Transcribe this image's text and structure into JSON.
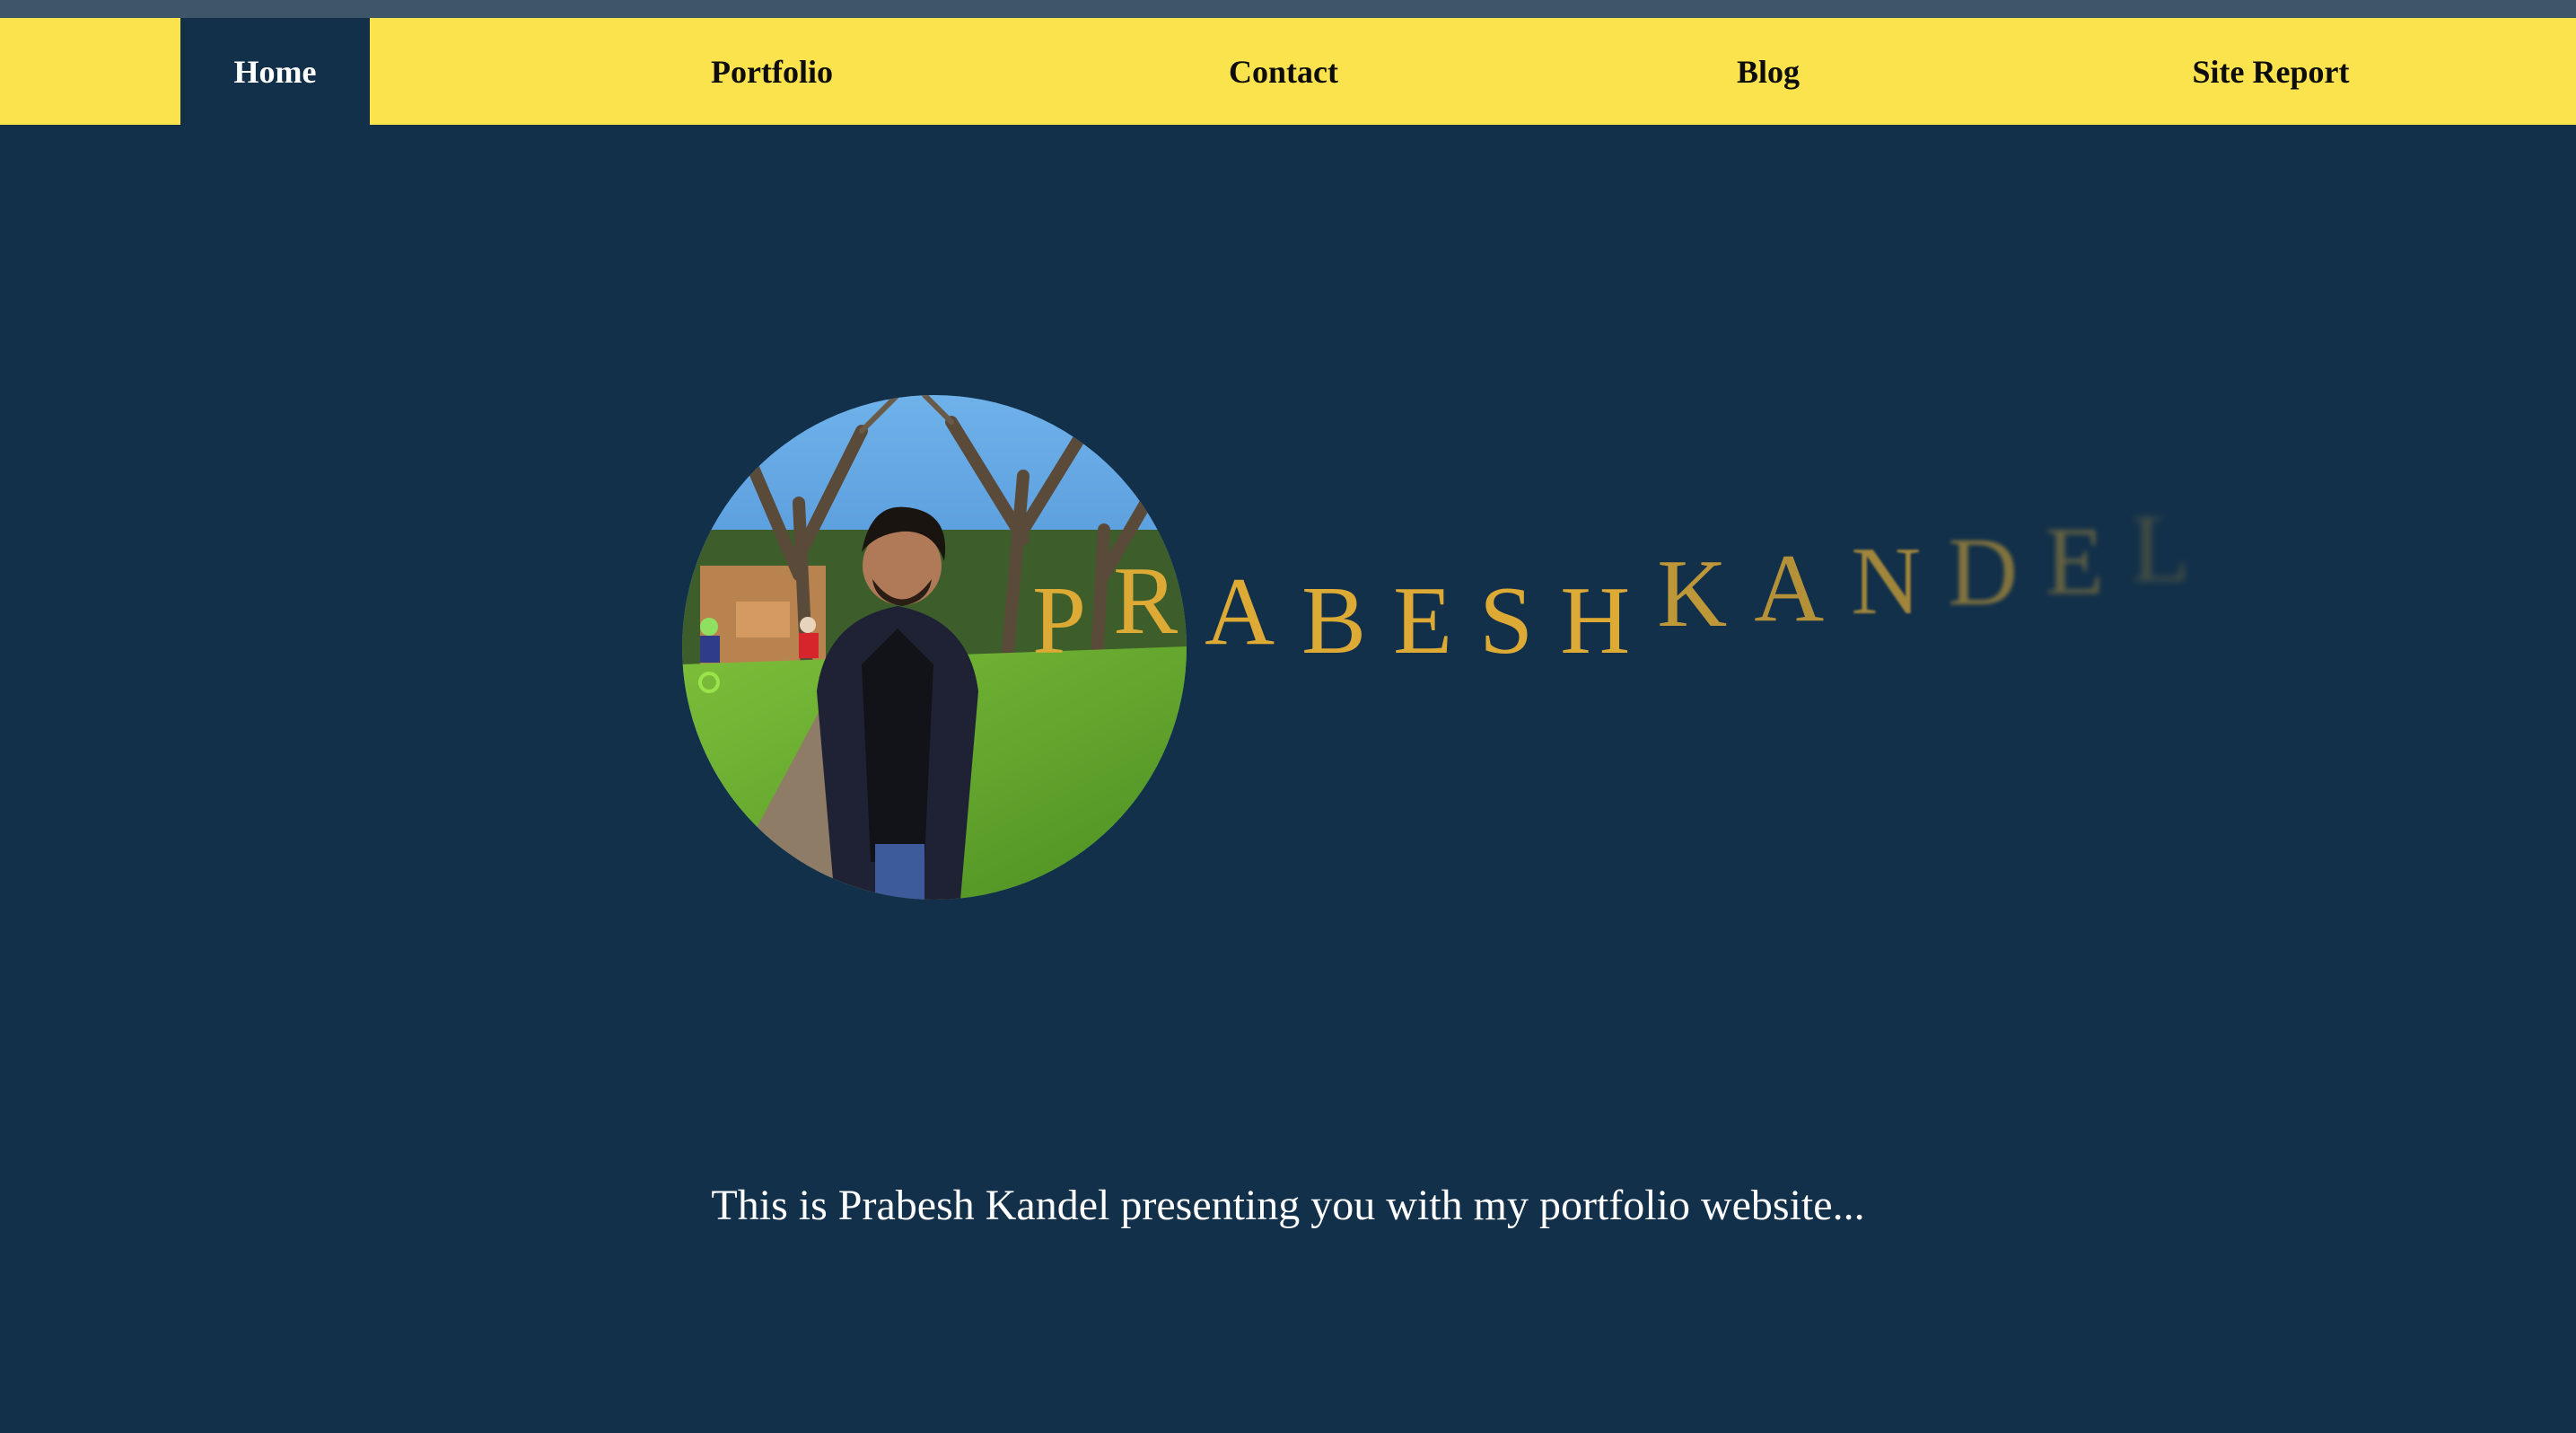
{
  "nav": {
    "items": [
      {
        "label": "Home",
        "active": true
      },
      {
        "label": "Portfolio",
        "active": false
      },
      {
        "label": "Contact",
        "active": false
      },
      {
        "label": "Blog",
        "active": false
      },
      {
        "label": "Site Report",
        "active": false
      }
    ]
  },
  "hero": {
    "first_name": "PRABESH",
    "last_name": "KANDEL",
    "photo_icon": "profile-photo",
    "tagline": "This is Prabesh Kandel presenting you with my portfolio website..."
  },
  "colors": {
    "background": "#12304a",
    "nav_background": "#fbe34d",
    "top_strip": "#3e5668",
    "name_gold": "#ddaa35",
    "text_white": "#ffffff"
  }
}
